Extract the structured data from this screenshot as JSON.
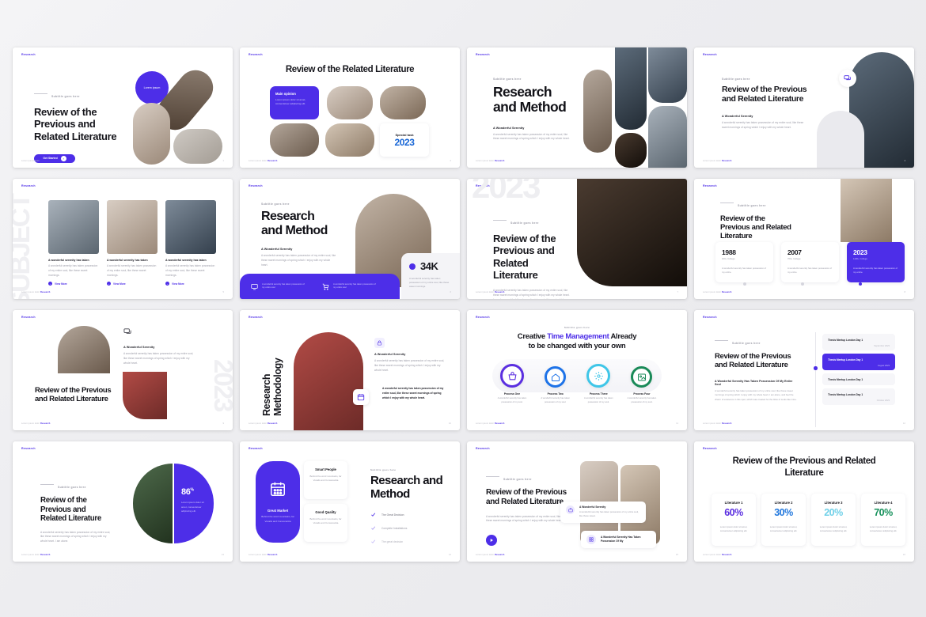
{
  "deck": {
    "brand": "Research",
    "footer_prefix": "Lorem ipsum dolor",
    "footer_brand": "Research"
  },
  "slides": [
    {
      "id": "slide-1",
      "name": "title-hero-shapes",
      "page": "1",
      "eyebrow": "Subtitle goes here",
      "title": "Review of the Previous and Related Literature",
      "button": "Get Started",
      "badge": "Lorem ipsum"
    },
    {
      "id": "slide-2",
      "name": "related-literature-gallery",
      "page": "2",
      "title": "Review of the Related Literature",
      "card_title": "Main opinion",
      "card_body": "Lorem ipsum dolor sit amet, consectetuer adipiscing elit.",
      "stat_label": "Special task",
      "stat_value": "2023"
    },
    {
      "id": "slide-3",
      "name": "research-method-collage",
      "page": "3",
      "eyebrow": "Subtitle goes here",
      "title": "Research and Method",
      "sub": "A Wonderful Serenity",
      "body": "A wonderful serenity has taken possession of my entire soul, like these sweet mornings of spring which I enjoy with my whole heart."
    },
    {
      "id": "slide-4",
      "name": "review-photo-right",
      "page": "4",
      "eyebrow": "Subtitle goes here",
      "title": "Review of the Previous and Related Literature",
      "sub": "A Wonderful Serenity",
      "body": "A wonderful serenity has taken possession of my entire soul, like these sweet mornings of spring which I enjoy with my whole heart.",
      "icon": "chat-bubble-icon"
    },
    {
      "id": "slide-5",
      "name": "subject-three-columns",
      "page": "5",
      "watermark": "SUBJECT",
      "columns": [
        {
          "title": "A wonderful serenity has taken",
          "body": "A wonderful serenity has taken possession of my entire soul, like these sweet mornings.",
          "link": "View More"
        },
        {
          "title": "A wonderful serenity has taken",
          "body": "A wonderful serenity has taken possession of my entire soul, like these sweet mornings.",
          "link": "View More"
        },
        {
          "title": "A wonderful serenity has taken",
          "body": "A wonderful serenity has taken possession of my entire soul, like these sweet mornings.",
          "link": "View More"
        }
      ]
    },
    {
      "id": "slide-6",
      "name": "research-method-stat",
      "page": "6",
      "eyebrow": "Subtitle goes here",
      "title": "Research and Method",
      "sub": "A Wonderful Serenity",
      "body": "A wonderful serenity has taken possession of my entire soul, like these sweet mornings of spring which I enjoy with my whole heart.",
      "stat_value": "34K",
      "stat_body": "A wonderful serenity has taken possession of my entire soul, like these sweet mornings.",
      "bar_items": [
        {
          "icon": "monitor-icon",
          "text": "A wonderful serenity has taken possession of my entire soul"
        },
        {
          "icon": "cart-icon",
          "text": "A wonderful serenity has taken possession of my entire soul"
        }
      ]
    },
    {
      "id": "slide-7",
      "name": "review-books-photo",
      "page": "7",
      "watermark": "2023",
      "eyebrow": "Subtitle goes here",
      "title": "Review of the Previous and Related Literature",
      "body": "A wonderful serenity has taken possession of my entire soul, like these sweet mornings of spring which I enjoy with my whole heart. I am alone, and feel the charm of existence in this spot, which was created for the bliss of souls like mine."
    },
    {
      "id": "slide-8",
      "name": "timeline-year-cards",
      "page": "8",
      "eyebrow": "Subtitle goes here",
      "title": "Review of the Previous and Related Literature",
      "cards": [
        {
          "year": "1988",
          "label": "100+ College",
          "body": "A wonderful serenity has taken possession of my entire.",
          "active": false
        },
        {
          "year": "2007",
          "label": "700+ College",
          "body": "A wonderful serenity has taken possession of my entire.",
          "active": false
        },
        {
          "year": "2023",
          "label": "1100+ College",
          "body": "A wonderful serenity has taken possession of my entire.",
          "active": true
        }
      ]
    },
    {
      "id": "slide-9",
      "name": "review-arch-photos",
      "page": "9",
      "watermark": "2023",
      "sub": "A Wonderful Serenity",
      "body": "A wonderful serenity has taken possession of my entire soul, like these sweet mornings of spring which I enjoy with my whole heart.",
      "title": "Review of the Previous and Related Literature",
      "icon": "chat-bubble-icon"
    },
    {
      "id": "slide-10",
      "name": "research-methodology-vertical",
      "page": "10",
      "title": "Research Methodology",
      "sub": "A Wonderful Serenity",
      "body": "A wonderful serenity has taken possession of my entire soul, like these sweet mornings of spring which I enjoy with my whole heart.",
      "quote": "A wonderful serenity has taken possession of my entire soul, like these sweet mornings of spring which I enjoy with my whole heart.",
      "icon_top": "lock-icon",
      "icon_bottom": "calendar-icon"
    },
    {
      "id": "slide-11",
      "name": "process-four-steps",
      "page": "11",
      "eyebrow": "Subtitle goes here",
      "title_a": "Creative ",
      "title_highlight": "Time Management",
      "title_b": " Already",
      "title_line2": "to be changed with your own",
      "steps": [
        {
          "label": "Process One",
          "body": "A wonderful serenity has taken possession of my soul.",
          "color": "#5b2fe0",
          "icon": "basket-icon"
        },
        {
          "label": "Process Two",
          "body": "A wonderful serenity has taken possession of my soul.",
          "color": "#1e73e8",
          "icon": "home-icon"
        },
        {
          "label": "Process Three",
          "body": "A wonderful serenity has taken possession of my soul.",
          "color": "#3fc6e8",
          "icon": "settings-icon"
        },
        {
          "label": "Process Four",
          "body": "A wonderful serenity has taken possession of my soul.",
          "color": "#1a8a58",
          "icon": "image-icon"
        }
      ]
    },
    {
      "id": "slide-12",
      "name": "agenda-timeline-list",
      "page": "12",
      "eyebrow": "Subtitle goes here",
      "title": "Review of the Previous and Related Literature",
      "sub": "A Wonderful Serenity Has Taken Possession Of My Entire Soul",
      "body": "A wonderful serenity has taken possession of my entire soul, like these sweet mornings of spring which I enjoy with my whole heart. I am alone, and feel the charm of existence in this spot, which was created for the bliss of souls like mine.",
      "events": [
        {
          "title": "Thesis Meetup London Day 1",
          "date": "September 2023",
          "active": false
        },
        {
          "title": "Thesis Meetup London Day 1",
          "date": "August 2023",
          "active": true
        },
        {
          "title": "Thesis Meetup London Day 1",
          "date": "",
          "active": false
        },
        {
          "title": "Thesis Meetup London Day 1",
          "date": "October 2023",
          "active": false
        }
      ]
    },
    {
      "id": "slide-13",
      "name": "review-percentage-circle",
      "page": "13",
      "eyebrow": "Subtitle goes here",
      "title": "Review of the Previous and Related Literature",
      "body": "A wonderful serenity has taken possession of my entire soul, like these sweet mornings of spring which I enjoy with my whole heart. I am alone.",
      "stat_value": "86",
      "stat_unit": "%",
      "stat_body": "Lorem ipsum dolor sit amet, consectetuer adipiscing elit."
    },
    {
      "id": "slide-14",
      "name": "features-research-method",
      "page": "14",
      "eyebrow": "Subtitle goes here",
      "title": "Research and Method",
      "feature_main": {
        "title": "Great Market",
        "body": "Behind the word mountains, far Vocalis and Consonantia",
        "icon": "calendar-icon"
      },
      "features": [
        {
          "title": "Smart People",
          "body": "Behind the word mountains, far Vocalis and Consonantia"
        },
        {
          "title": "Good Quality",
          "body": "Behind the word mountains, far Vocalis and Consonantia"
        }
      ],
      "checks": [
        "The Great Decision",
        "Complete Installations",
        "The great decision"
      ]
    },
    {
      "id": "slide-15",
      "name": "review-mobile-cards",
      "page": "15",
      "eyebrow": "Subtitle goes here",
      "title": "Review of the Previous and Related Literature",
      "body": "A wonderful serenity has taken possession of my entire soul, like these sweet mornings of spring which I enjoy with my whole heart.",
      "play_icon": "play-icon",
      "float_card_1": {
        "title": "A Wonderful Serenity",
        "body": "A wonderful serenity has taken possession of my entire soul, like these sweet.",
        "icon": "briefcase-icon"
      },
      "float_card_2": {
        "title": "A Wonderful Serenity Has Taken Possession Of My",
        "icon": "grid-icon"
      }
    },
    {
      "id": "slide-16",
      "name": "literature-stat-cards",
      "page": "16",
      "title": "Review of the Previous and Related Literature",
      "cards": [
        {
          "label": "Literature 1",
          "value": "60%",
          "color": "#5b2fe0",
          "body": "Lorem ipsum dolor sit amet, consectetuer adipiscing elit."
        },
        {
          "label": "Literature 2",
          "value": "30%",
          "color": "#2278dd",
          "body": "Lorem ipsum dolor sit amet, consectetuer adipiscing elit."
        },
        {
          "label": "Literature 3",
          "value": "20%",
          "color": "#6fd0e8",
          "body": "Lorem ipsum dolor sit amet, consectetuer adipiscing elit."
        },
        {
          "label": "Literature 4",
          "value": "70%",
          "color": "#17915c",
          "body": "Lorem ipsum dolor sit amet, consectetuer adipiscing elit."
        }
      ]
    }
  ]
}
